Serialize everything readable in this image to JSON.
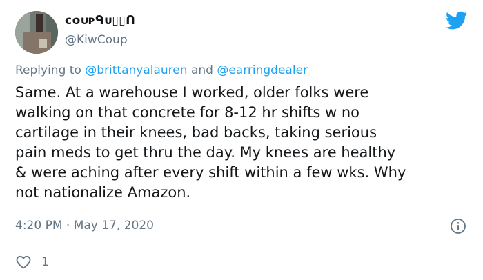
{
  "author": {
    "display_name": "ᴄᴏᴜᴘᑫᴜ▯▯ᑎ",
    "handle": "@KiwCoup",
    "avatar_icon": "avatar-photo"
  },
  "brand_icon": "twitter-bird-icon",
  "reply_context": {
    "prefix": "Replying to",
    "mention_1": "@brittanyalauren",
    "joiner": "and",
    "mention_2": "@earringdealer"
  },
  "tweet": {
    "lines": [
      "Same. At a warehouse I worked, older folks were",
      "walking on that concrete for 8-12 hr shifts w no",
      "cartilage in their knees, bad backs, taking serious",
      "pain meds to get thru the day. My knees are healthy",
      "& were aching after every shift within a few wks. Why",
      "not nationalize Amazon."
    ],
    "timestamp": "4:20 PM · May 17, 2020"
  },
  "actions": {
    "like_icon": "heart-icon",
    "like_count": "1",
    "info_icon": "info-icon"
  },
  "colors": {
    "accent": "#1da1f2",
    "secondary_text": "#657786",
    "primary_text": "#14171a",
    "divider": "#e1e8ed"
  }
}
